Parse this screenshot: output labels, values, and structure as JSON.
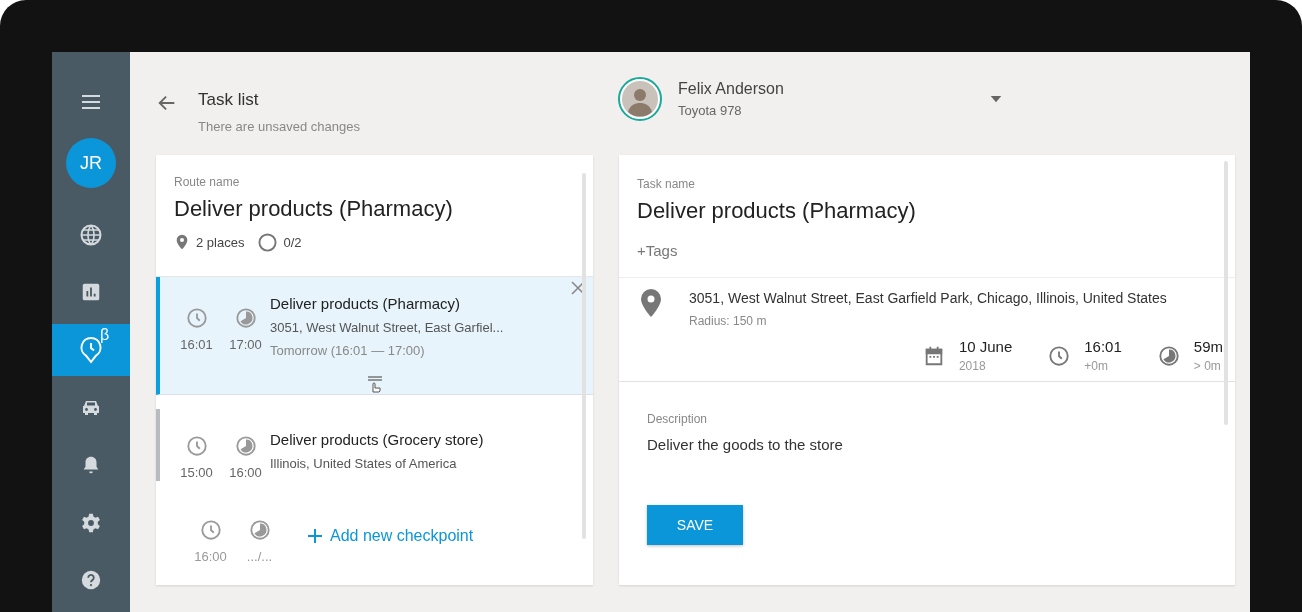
{
  "sidebar": {
    "items": [
      {
        "kind": "menu",
        "selected": false
      },
      {
        "kind": "avatar",
        "initials": "JR",
        "selected": false
      },
      {
        "kind": "globe",
        "selected": false
      },
      {
        "kind": "chart",
        "selected": false
      },
      {
        "kind": "tracking",
        "badge": "β",
        "selected": true
      },
      {
        "kind": "car",
        "selected": false
      },
      {
        "kind": "bell",
        "selected": false
      },
      {
        "kind": "gear",
        "selected": false
      },
      {
        "kind": "help",
        "selected": false
      }
    ]
  },
  "header": {
    "title": "Task list",
    "subtitle": "There are unsaved changes"
  },
  "driver": {
    "name": "Felix Anderson",
    "vehicle": "Toyota 978"
  },
  "route": {
    "label": "Route name",
    "name": "Deliver products (Pharmacy)",
    "places": "2 places",
    "progress": "0/2",
    "checkpoints": [
      {
        "start": "16:01",
        "end": "17:00",
        "title": "Deliver products (Pharmacy)",
        "address": "3051, West Walnut Street, East Garfiel...",
        "schedule": "Tomorrow (16:01 — 17:00)",
        "selected": true
      },
      {
        "start": "15:00",
        "end": "16:00",
        "title": "Deliver products (Grocery store)",
        "address": "Illinois, United States of America",
        "selected": false
      }
    ],
    "new_checkpoint": {
      "start": "16:00",
      "end": ".../...",
      "action": "Add new checkpoint"
    }
  },
  "task": {
    "label": "Task name",
    "name": "Deliver products (Pharmacy)",
    "tags": "+Tags",
    "address": "3051, West Walnut Street, East Garfield Park, Chicago, Illinois, United States",
    "radius": "Radius: 150 m",
    "date": "10 June",
    "year": "2018",
    "time": "16:01",
    "time_offset": "+0m",
    "duration": "59m",
    "duration_note": "> 0m",
    "description_label": "Description",
    "description": "Deliver the goods to the store",
    "save": "SAVE"
  }
}
